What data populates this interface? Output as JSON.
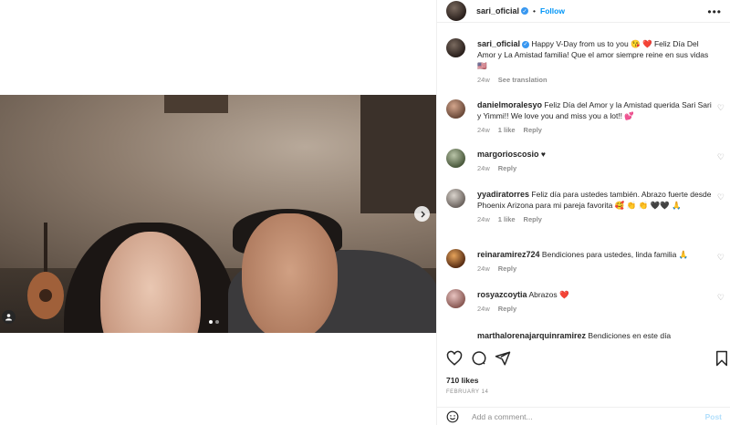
{
  "post": {
    "author": "sari_oficial",
    "follow_label": "Follow",
    "more_label": "•••"
  },
  "caption": {
    "username": "sari_oficial",
    "text": "Happy V-Day from us to you 😘 ❤️ Feliz Día Del Amor y La Amistad familia! Que el amor siempre reine en sus vidas 🇺🇸",
    "time": "24w",
    "see_translation": "See translation"
  },
  "comments": [
    {
      "username": "danielmoralesyo",
      "text": "Feliz Día del Amor y la Amistad querida Sari Sari y Yimmi!! We love you and miss you a lot!! 💕",
      "time": "24w",
      "likes": "1 like",
      "reply": "Reply"
    },
    {
      "username": "margorioscosio",
      "text": "♥",
      "time": "24w",
      "likes": "",
      "reply": "Reply"
    },
    {
      "username": "yyadiratorres",
      "text": "Feliz día para ustedes también. Abrazo fuerte desde Phoenix Arizona para mi pareja favorita 🥰 👏 👏 🖤🖤 🙏",
      "time": "24w",
      "likes": "1 like",
      "reply": "Reply"
    },
    {
      "username": "reinaramirez724",
      "text": "Bendiciones para ustedes, linda familia 🙏",
      "time": "24w",
      "likes": "",
      "reply": "Reply"
    },
    {
      "username": "rosyazcoytia",
      "text": "Abrazos ❤️",
      "time": "24w",
      "likes": "",
      "reply": "Reply"
    },
    {
      "username": "marthalorenajarquinramirez",
      "text": "Bendiciones en este día",
      "time": "",
      "likes": "",
      "reply": ""
    }
  ],
  "likes_count": "710 likes",
  "date": "FEBRUARY 14",
  "add_comment": {
    "placeholder": "Add a comment...",
    "post_label": "Post"
  },
  "icons": [
    "heart-icon",
    "comment-icon",
    "share-icon",
    "bookmark-icon",
    "emoji-icon",
    "chevron-right-icon",
    "tag-user-icon",
    "verified-icon"
  ],
  "colors": {
    "link": "#0095f6",
    "muted": "#8e8e8e",
    "verified": "#3897f0"
  }
}
